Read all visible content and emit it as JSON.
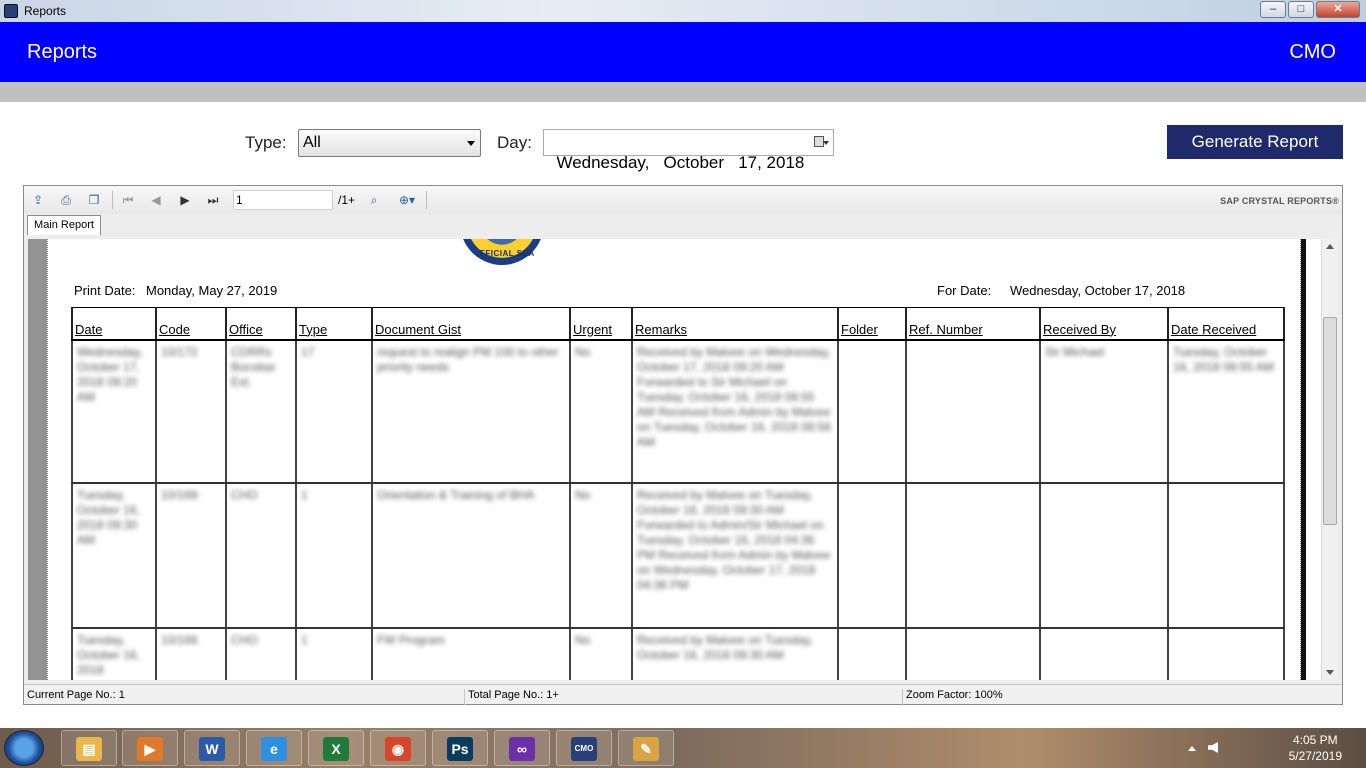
{
  "window": {
    "title": "Reports",
    "buttons": {
      "minimize": "–",
      "maximize": "□",
      "close": "✕"
    }
  },
  "header": {
    "title": "Reports",
    "user": "CMO",
    "color": "#0000ff"
  },
  "filters": {
    "type_label": "Type:",
    "type_value": "All",
    "day_label": "Day:",
    "day_value": "Wednesday,   October   17, 2018",
    "generate_label": "Generate Report"
  },
  "viewer": {
    "page_input": "1",
    "page_total": "/1+",
    "brand": "SAP CRYSTAL REPORTS®",
    "tab_label": "Main Report",
    "status": {
      "current_page": "Current Page No.: 1",
      "total_page": "Total Page No.: 1+",
      "zoom": "Zoom Factor: 100%"
    }
  },
  "report": {
    "seal_text": "FFICIAL SEA",
    "print_date_label": "Print Date:",
    "print_date": "Monday, May 27, 2019",
    "for_date_label": "For Date:",
    "for_date": "Wednesday, October 17, 2018",
    "columns": [
      "Date",
      "Code",
      "Office",
      "Type",
      "Document Gist",
      "Urgent",
      "Remarks",
      "Folder",
      "Ref. Number",
      "Received By",
      "Date Received"
    ],
    "rows": [
      [
        "Wednesday, October 17, 2018 09:20 AM",
        "10/172",
        "CDRRs Bocobar Ext.",
        "17",
        "request to realign PM 100 to other priority needs",
        "No",
        "Received by Malvee on Wednesday, October 17, 2018 09:20 AM Forwarded to Sir Michael on Tuesday, October 16, 2018 08:55 AM Received from Admin by Malvee on Tuesday, October 16, 2018 08:56 AM",
        "",
        "",
        "Sir Michael",
        "Tuesday, October 16, 2018 08:55 AM"
      ],
      [
        "Tuesday, October 16, 2018 09:30 AM",
        "10/169",
        "CHO",
        "1",
        "Orientation & Training of BHA",
        "No",
        "Received by Malvee on Tuesday, October 16, 2018 09:30 AM Forwarded to Admin/Sir Michael on Tuesday, October 16, 2018 04:36 PM Received from Admin by Malvee on Wednesday, October 17, 2018 04:36 PM",
        "",
        "",
        "",
        ""
      ],
      [
        "Tuesday, October 16, 2018",
        "10/166",
        "CHO",
        "1",
        "FW Program",
        "No",
        "Received by Malvee on Tuesday, October 16, 2018 09:30 AM",
        "",
        "",
        "",
        ""
      ]
    ]
  },
  "taskbar": {
    "time": "4:05 PM",
    "date": "5/27/2019",
    "apps": [
      {
        "name": "explorer",
        "glyph": "▤",
        "color": "#e8b84a"
      },
      {
        "name": "media-player",
        "glyph": "▶",
        "color": "#e07a2a"
      },
      {
        "name": "word",
        "glyph": "W",
        "color": "#2b5aa8"
      },
      {
        "name": "internet-explorer",
        "glyph": "e",
        "color": "#2f8fe0"
      },
      {
        "name": "excel",
        "glyph": "X",
        "color": "#1f7a3c"
      },
      {
        "name": "chrome",
        "glyph": "◉",
        "color": "#d9452b"
      },
      {
        "name": "photoshop",
        "glyph": "Ps",
        "color": "#0b3c5d"
      },
      {
        "name": "visual-studio",
        "glyph": "∞",
        "color": "#6b2fa8"
      },
      {
        "name": "cmo-app",
        "glyph": "CMO",
        "color": "#2a3f7a"
      },
      {
        "name": "paint",
        "glyph": "✎",
        "color": "#d9a441"
      }
    ]
  }
}
